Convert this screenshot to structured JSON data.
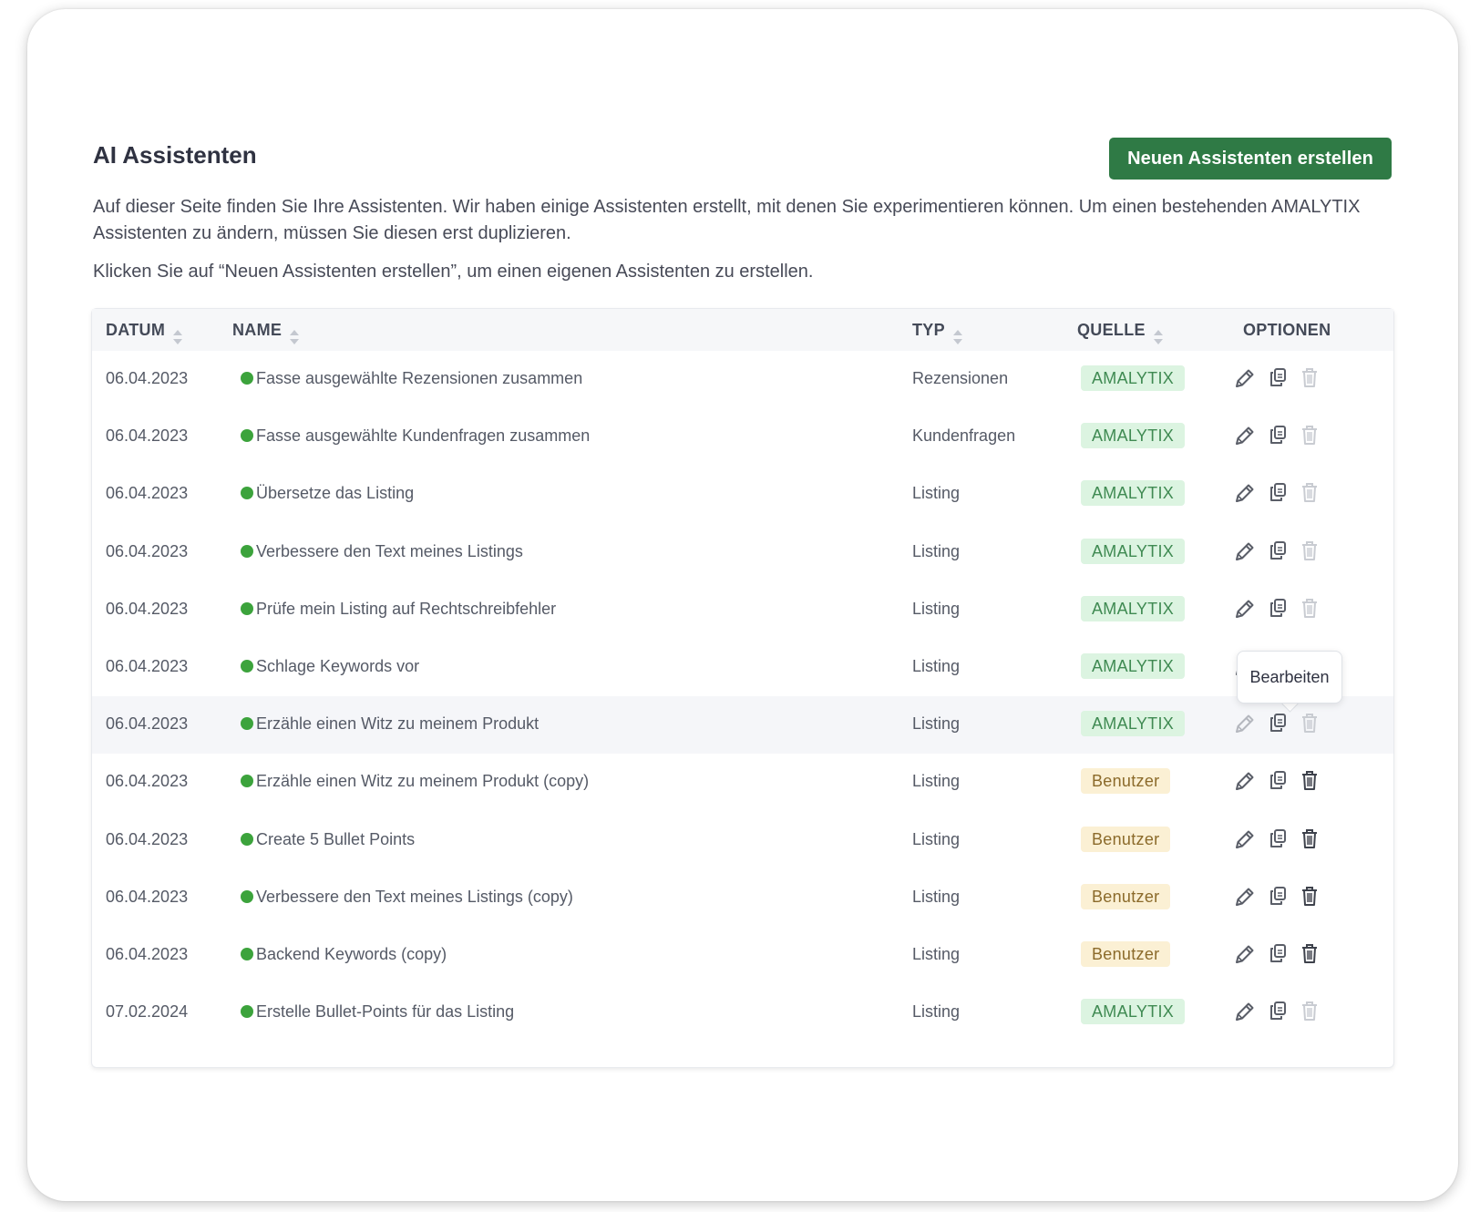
{
  "header": {
    "title": "AI Assistenten",
    "create_button": "Neuen Assistenten erstellen",
    "description": "Auf dieser Seite finden Sie Ihre Assistenten. Wir haben einige Assistenten erstellt, mit denen Sie experimentieren können. Um einen bestehenden AMALYTIX Assistenten zu ändern, müssen Sie diesen erst duplizieren.",
    "hint": "Klicken Sie auf “Neuen Assistenten erstellen”, um einen eigenen Assistenten zu erstellen."
  },
  "table": {
    "columns": {
      "datum": "DATUM",
      "name": "NAME",
      "typ": "TYP",
      "quelle": "QUELLE",
      "optionen": "OPTIONEN"
    },
    "rows": [
      {
        "datum": "06.04.2023",
        "name": "Fasse ausgewählte Rezensionen zusammen",
        "typ": "Rezensionen",
        "quelle": "AMALYTIX",
        "status": "active"
      },
      {
        "datum": "06.04.2023",
        "name": "Fasse ausgewählte Kundenfragen zusammen",
        "typ": "Kundenfragen",
        "quelle": "AMALYTIX",
        "status": "active"
      },
      {
        "datum": "06.04.2023",
        "name": "Übersetze das Listing",
        "typ": "Listing",
        "quelle": "AMALYTIX",
        "status": "active"
      },
      {
        "datum": "06.04.2023",
        "name": "Verbessere den Text meines Listings",
        "typ": "Listing",
        "quelle": "AMALYTIX",
        "status": "active"
      },
      {
        "datum": "06.04.2023",
        "name": "Prüfe mein Listing auf Rechtschreibfehler",
        "typ": "Listing",
        "quelle": "AMALYTIX",
        "status": "active"
      },
      {
        "datum": "06.04.2023",
        "name": "Schlage Keywords vor",
        "typ": "Listing",
        "quelle": "AMALYTIX",
        "status": "active"
      },
      {
        "datum": "06.04.2023",
        "name": "Erzähle einen Witz zu meinem Produkt",
        "typ": "Listing",
        "quelle": "AMALYTIX",
        "status": "active"
      },
      {
        "datum": "06.04.2023",
        "name": "Erzähle einen Witz zu meinem Produkt (copy)",
        "typ": "Listing",
        "quelle": "Benutzer",
        "status": "active"
      },
      {
        "datum": "06.04.2023",
        "name": "Create 5 Bullet Points",
        "typ": "Listing",
        "quelle": "Benutzer",
        "status": "active"
      },
      {
        "datum": "06.04.2023",
        "name": "Verbessere den Text meines Listings (copy)",
        "typ": "Listing",
        "quelle": "Benutzer",
        "status": "active"
      },
      {
        "datum": "06.04.2023",
        "name": "Backend Keywords (copy)",
        "typ": "Listing",
        "quelle": "Benutzer",
        "status": "active"
      },
      {
        "datum": "07.02.2024",
        "name": "Erstelle Bullet-Points für das Listing",
        "typ": "Listing",
        "quelle": "AMALYTIX",
        "status": "active"
      }
    ],
    "icons": {
      "sort": "sort-icon",
      "edit": "pencil-icon",
      "duplicate": "copy-icon",
      "delete": "trash-icon",
      "status": "status-dot"
    }
  },
  "tooltip": {
    "text": "Bearbeiten"
  },
  "colors": {
    "primary_button": "#2f7a45",
    "status_dot": "#3ca33c",
    "badge_amalytix_bg": "#dcf4e1",
    "badge_amalytix_text": "#3f8a52",
    "badge_benutzer_bg": "#fbf0d4",
    "badge_benutzer_text": "#8b6a2a"
  }
}
